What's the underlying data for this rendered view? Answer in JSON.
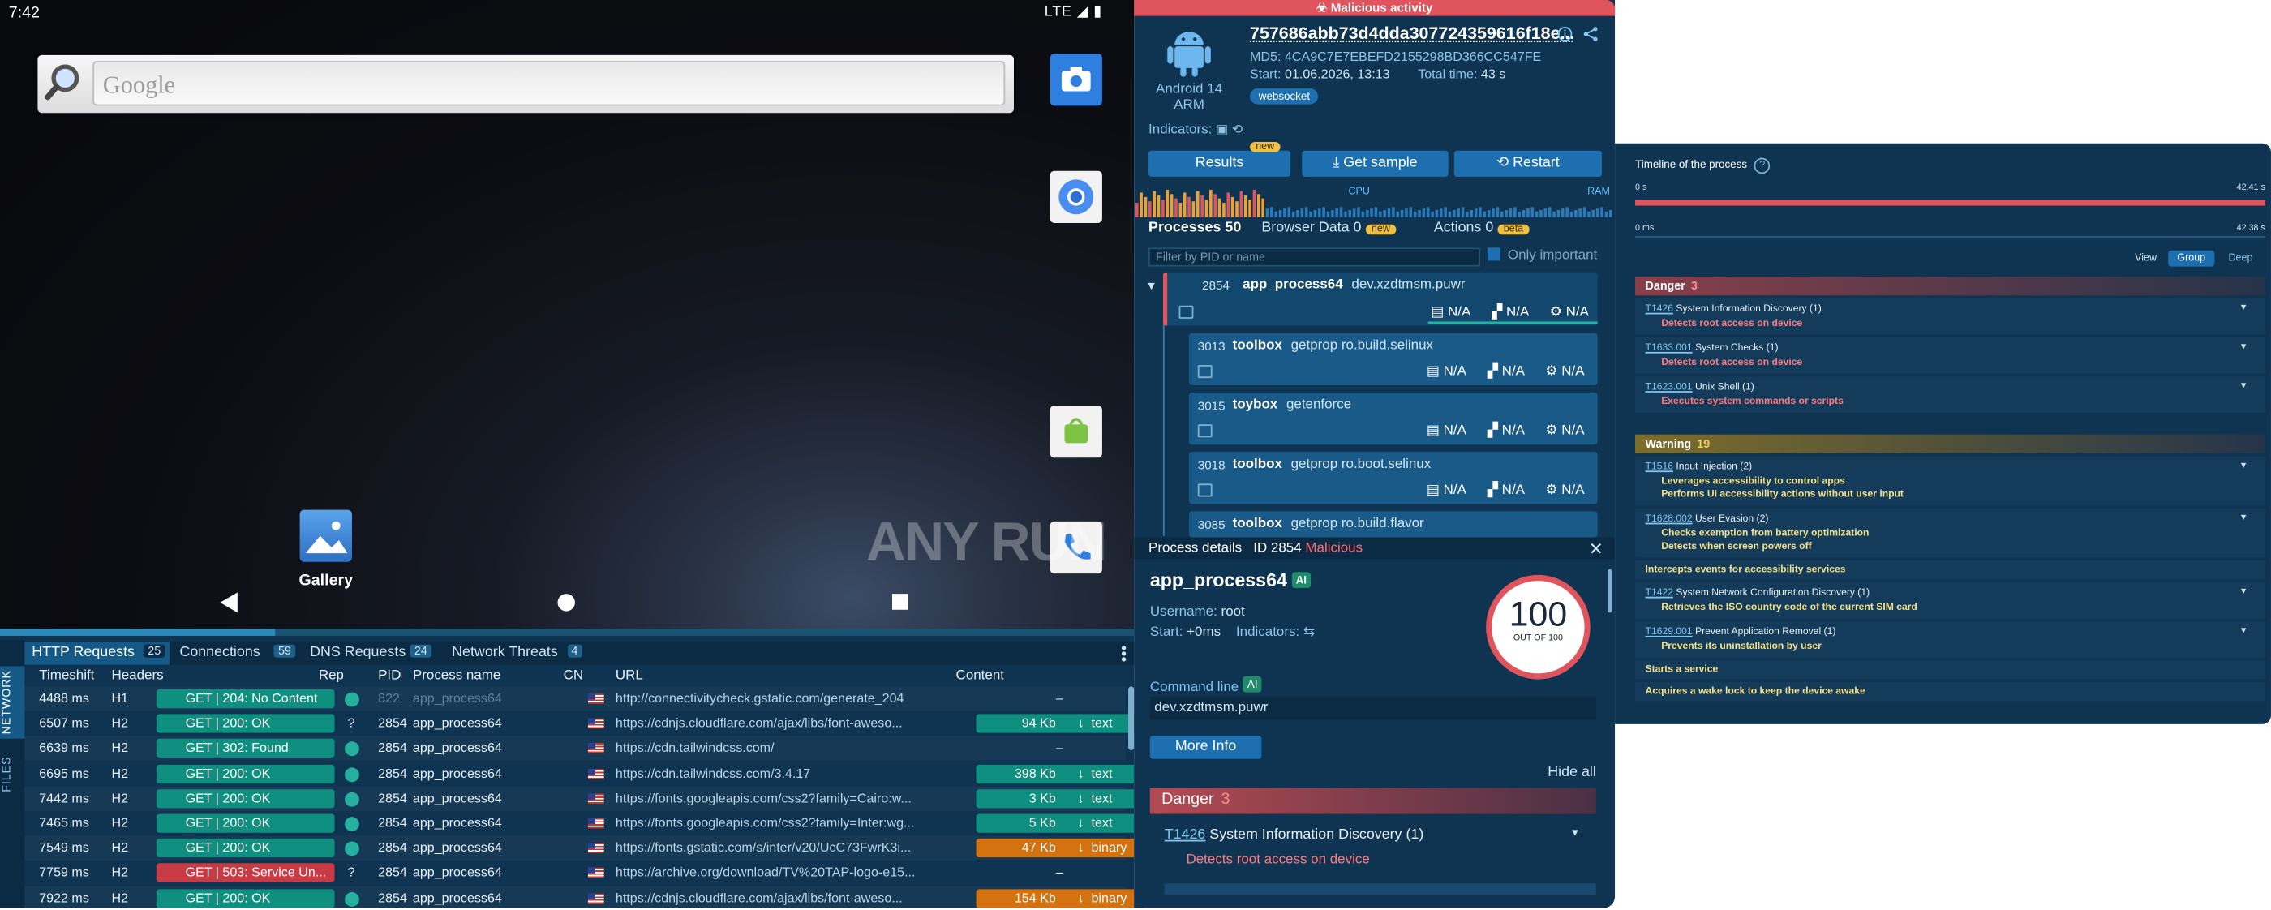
{
  "android": {
    "time": "7:42",
    "status_right": "LTE",
    "search_placeholder": "Google",
    "gallery_label": "Gallery",
    "watermark": "ANY RUN"
  },
  "network": {
    "side_tabs": [
      "NETWORK",
      "FILES"
    ],
    "tabs": [
      {
        "label": "HTTP Requests",
        "count": "25"
      },
      {
        "label": "Connections",
        "count": "59"
      },
      {
        "label": "DNS Requests",
        "count": "24"
      },
      {
        "label": "Network Threats",
        "count": "4"
      }
    ],
    "columns": [
      "Timeshift",
      "Headers",
      "Rep",
      "PID",
      "Process name",
      "CN",
      "URL",
      "Content"
    ],
    "rows": [
      {
        "time": "4488 ms",
        "proto": "H1",
        "status": "GET  |  204: No Content",
        "rep": "ok",
        "pid": "822",
        "proc": "app_process64",
        "url": "http://connectivitycheck.gstatic.com/generate_204",
        "size": "",
        "type": "–",
        "kind": "empty",
        "dim": true
      },
      {
        "time": "6507 ms",
        "proto": "H2",
        "status": "GET  |  200: OK",
        "rep": "?",
        "pid": "2854",
        "proc": "app_process64",
        "url": "https://cdnjs.cloudflare.com/ajax/libs/font-aweso...",
        "size": "94 Kb",
        "type": "text",
        "kind": "text",
        "dim": false
      },
      {
        "time": "6639 ms",
        "proto": "H2",
        "status": "GET  |  302: Found",
        "rep": "ok",
        "pid": "2854",
        "proc": "app_process64",
        "url": "https://cdn.tailwindcss.com/",
        "size": "",
        "type": "–",
        "kind": "empty",
        "dim": false
      },
      {
        "time": "6695 ms",
        "proto": "H2",
        "status": "GET  |  200: OK",
        "rep": "ok",
        "pid": "2854",
        "proc": "app_process64",
        "url": "https://cdn.tailwindcss.com/3.4.17",
        "size": "398 Kb",
        "type": "text",
        "kind": "text",
        "dim": false
      },
      {
        "time": "7442 ms",
        "proto": "H2",
        "status": "GET  |  200: OK",
        "rep": "ok",
        "pid": "2854",
        "proc": "app_process64",
        "url": "https://fonts.googleapis.com/css2?family=Cairo:w...",
        "size": "3 Kb",
        "type": "text",
        "kind": "text",
        "dim": false
      },
      {
        "time": "7465 ms",
        "proto": "H2",
        "status": "GET  |  200: OK",
        "rep": "ok",
        "pid": "2854",
        "proc": "app_process64",
        "url": "https://fonts.googleapis.com/css2?family=Inter:wg...",
        "size": "5 Kb",
        "type": "text",
        "kind": "text",
        "dim": false
      },
      {
        "time": "7549 ms",
        "proto": "H2",
        "status": "GET  |  200: OK",
        "rep": "ok",
        "pid": "2854",
        "proc": "app_process64",
        "url": "https://fonts.gstatic.com/s/inter/v20/UcC73FwrK3i...",
        "size": "47 Kb",
        "type": "binary",
        "kind": "bin",
        "dim": false
      },
      {
        "time": "7759 ms",
        "proto": "H2",
        "status": "GET  |  503: Service Un...",
        "rep": "?",
        "pid": "2854",
        "proc": "app_process64",
        "url": "https://archive.org/download/TV%20TAP-logo-e15...",
        "size": "",
        "type": "–",
        "kind": "empty",
        "err": true,
        "dim": false
      },
      {
        "time": "7922 ms",
        "proto": "H2",
        "status": "GET  |  200: OK",
        "rep": "ok",
        "pid": "2854",
        "proc": "app_process64",
        "url": "https://cdnjs.cloudflare.com/ajax/libs/font-aweso...",
        "size": "154 Kb",
        "type": "binary",
        "kind": "bin",
        "dim": false
      }
    ]
  },
  "task": {
    "banner": "Malicious activity",
    "os": "Android 14",
    "arch": "ARM",
    "hash": "757686abb73d4dda307724359616f18e...",
    "md5_label": "MD5:",
    "md5": "4CA9C7E7EBEFD2155298BD366CC547FE",
    "start_label": "Start:",
    "start": "01.06.2026, 13:13",
    "total_label": "Total time:",
    "total": "43 s",
    "tag": "websocket",
    "indicators_label": "Indicators:",
    "buttons": {
      "results": "Results",
      "new_badge": "new",
      "sample": "Get sample",
      "restart": "Restart"
    },
    "cpu_label": "CPU",
    "ram_label": "RAM",
    "tabs": {
      "processes": "Processes",
      "processes_count": "50",
      "browser": "Browser Data",
      "browser_count": "0",
      "browser_badge": "new",
      "actions": "Actions",
      "actions_count": "0",
      "actions_badge": "beta"
    },
    "filter_placeholder": "Filter by PID or name",
    "only_important": "Only important",
    "processes": [
      {
        "pid": "2854",
        "name": "app_process64",
        "cmd": "dev.xzdtmsm.puwr",
        "na": "N/A"
      },
      {
        "pid": "3013",
        "name": "toolbox",
        "cmd": "getprop ro.build.selinux",
        "na": "N/A"
      },
      {
        "pid": "3015",
        "name": "toybox",
        "cmd": "getenforce",
        "na": "N/A"
      },
      {
        "pid": "3018",
        "name": "toolbox",
        "cmd": "getprop ro.boot.selinux",
        "na": "N/A"
      },
      {
        "pid": "3085",
        "name": "toolbox",
        "cmd": "getprop ro.build.flavor",
        "na": "N/A"
      }
    ]
  },
  "details": {
    "header": "Process details",
    "id_label": "ID 2854",
    "verdict": "Malicious",
    "name": "app_process64",
    "ai": "AI",
    "username_label": "Username:",
    "username": "root",
    "start_label": "Start:",
    "start": "+0ms",
    "indicators_label": "Indicators:",
    "score": "100",
    "score_of": "OUT OF 100",
    "cmd_label": "Command line",
    "cmd": "dev.xzdtmsm.puwr",
    "more": "More Info",
    "hide_all": "Hide all",
    "danger": "Danger",
    "danger_count": "3",
    "tech_id": "T1426",
    "tech_name": "System Information Discovery (1)",
    "tech_detail": "Detects root access on device"
  },
  "timeline": {
    "title": "Timeline of the process",
    "axis": {
      "start1": "0 s",
      "end1": "42.41 s",
      "start2": "0 ms",
      "end2": "42.38 s"
    },
    "view_label": "View",
    "view_group": "Group",
    "view_deep": "Deep",
    "danger": "Danger",
    "danger_count": "3",
    "warning": "Warning",
    "warning_count": "19",
    "danger_items": [
      {
        "id": "T1426",
        "name": "System Information Discovery (1)",
        "subs": [
          "Detects root access on device"
        ]
      },
      {
        "id": "T1633.001",
        "name": "System Checks (1)",
        "subs": [
          "Detects root access on device"
        ]
      },
      {
        "id": "T1623.001",
        "name": "Unix Shell (1)",
        "subs": [
          "Executes system commands or scripts"
        ]
      }
    ],
    "warning_items": [
      {
        "id": "T1516",
        "name": "Input Injection (2)",
        "subs": [
          "Leverages accessibility to control apps",
          "Performs UI accessibility actions without user input"
        ]
      },
      {
        "id": "T1628.002",
        "name": "User Evasion (2)",
        "subs": [
          "Checks exemption from battery optimization",
          "Detects when screen powers off"
        ]
      },
      {
        "id": "",
        "name": "Intercepts events for accessibility services",
        "subs": []
      },
      {
        "id": "T1422",
        "name": "System Network Configuration Discovery (1)",
        "subs": [
          "Retrieves the ISO country code of the current SIM card"
        ]
      },
      {
        "id": "T1629.001",
        "name": "Prevent Application Removal (1)",
        "subs": [
          "Prevents its uninstallation by user"
        ]
      },
      {
        "id": "",
        "name": "Starts a service",
        "subs": []
      },
      {
        "id": "",
        "name": "Acquires a wake lock to keep the device awake",
        "subs": []
      }
    ]
  }
}
